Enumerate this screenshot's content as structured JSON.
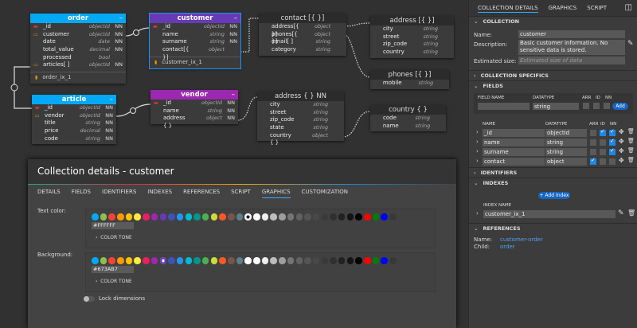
{
  "entities": [
    {
      "id": "order",
      "title": "order",
      "color": "#03A9F4",
      "rows": [
        [
          "key",
          "_id",
          "objectId",
          "NN"
        ],
        [
          "fk",
          "customer",
          "objectId",
          "NN"
        ],
        [
          "",
          "date",
          "date",
          "NN"
        ],
        [
          "",
          "total_value",
          "decimal",
          "NN"
        ],
        [
          "",
          "processed",
          "bool",
          ""
        ],
        [
          "fk",
          "articles[ ]",
          "objectId",
          "NN"
        ]
      ],
      "index": "order_ix_1"
    },
    {
      "id": "customer",
      "title": "customer",
      "color": "#673AB7",
      "rows": [
        [
          "key",
          "_id",
          "objectId",
          "NN"
        ],
        [
          "",
          "name",
          "string",
          "NN"
        ],
        [
          "",
          "surname",
          "string",
          "NN"
        ],
        [
          "",
          "contact[{ }]",
          "object",
          ""
        ]
      ],
      "index": "customer_ix_1"
    },
    {
      "id": "article",
      "title": "article",
      "color": "#03A9F4",
      "rows": [
        [
          "key",
          "_id",
          "objectId",
          "NN"
        ],
        [
          "fk",
          "vendor",
          "objectId",
          "NN"
        ],
        [
          "",
          "title",
          "string",
          "NN"
        ],
        [
          "",
          "price",
          "decimal",
          "NN"
        ],
        [
          "",
          "code",
          "string",
          "NN"
        ]
      ]
    },
    {
      "id": "vendor",
      "title": "vendor",
      "color": "#9C27B0",
      "rows": [
        [
          "key",
          "_id",
          "objectId",
          "NN"
        ],
        [
          "",
          "name",
          "string",
          "NN"
        ],
        [
          "",
          "address { }",
          "object",
          "NN"
        ]
      ]
    },
    {
      "id": "contact",
      "title": "contact [{ }]",
      "sub": true,
      "rows": [
        [
          "",
          "address[{ }]",
          "object",
          ""
        ],
        [
          "",
          "phones[{ }]",
          "object",
          ""
        ],
        [
          "",
          "email[ ]",
          "string",
          ""
        ],
        [
          "",
          "category",
          "string",
          ""
        ]
      ]
    },
    {
      "id": "address1",
      "title": "address [{ }]",
      "sub": true,
      "rows": [
        [
          "",
          "city",
          "string",
          ""
        ],
        [
          "",
          "street",
          "string",
          ""
        ],
        [
          "",
          "zip_code",
          "string",
          ""
        ],
        [
          "",
          "country",
          "string",
          ""
        ]
      ]
    },
    {
      "id": "phones",
      "title": "phones [{ }]",
      "sub": true,
      "rows": [
        [
          "",
          "mobile",
          "string",
          ""
        ]
      ]
    },
    {
      "id": "address2",
      "title": "address { } NN",
      "sub": true,
      "rows": [
        [
          "",
          "city",
          "string",
          ""
        ],
        [
          "",
          "street",
          "string",
          ""
        ],
        [
          "",
          "zip_code",
          "string",
          ""
        ],
        [
          "",
          "state",
          "string",
          ""
        ],
        [
          "",
          "country { }",
          "object",
          ""
        ]
      ]
    },
    {
      "id": "country",
      "title": "country { }",
      "sub": true,
      "rows": [
        [
          "",
          "code",
          "string",
          ""
        ],
        [
          "",
          "name",
          "string",
          ""
        ]
      ]
    }
  ],
  "dialog": {
    "title": "Collection details - customer",
    "tabs": [
      "DETAILS",
      "FIELDS",
      "IDENTIFIERS",
      "INDEXES",
      "REFERENCES",
      "SCRIPT",
      "GRAPHICS",
      "CUSTOMIZATION"
    ],
    "active_tab": "GRAPHICS",
    "text_color_label": "Text color:",
    "text_color_value": "#FFFFFF",
    "text_selected": 18,
    "background_label": "Background:",
    "background_value": "#673AB7",
    "background_selected": 8,
    "color_tone": "COLOR TONE",
    "lock_label": "Lock dimensions",
    "palette": [
      "#03A9F4",
      "#8BC34A",
      "#F44336",
      "#FF9800",
      "#FFC107",
      "#FFEB3B",
      "#E91E63",
      "#9C27B0",
      "#673AB7",
      "#3F51B5",
      "#2196F3",
      "#00BCD4",
      "#009688",
      "#4CAF50",
      "#CDDC39",
      "#FF5722",
      "#795548",
      "#607D8B",
      "#FFFFFF",
      "#FAFAFA",
      "#EEEEEE",
      "#BDBDBD",
      "#9E9E9E",
      "#757575",
      "#616161",
      "#545454",
      "#484848",
      "#3a3a3a",
      "#303030",
      "#212121",
      "#141414",
      "#000000",
      "#FF0000",
      "#008000",
      "#0000FF",
      "#383838"
    ]
  },
  "panel": {
    "tabs": [
      "COLLECTION DETAILS",
      "GRAPHICS",
      "SCRIPT"
    ],
    "collection": "COLLECTION",
    "name_label": "Name:",
    "name_value": "customer",
    "desc_label": "Description:",
    "desc_value": "Basic customer information. No sensitive data is stored.",
    "size_label": "Estimated size:",
    "size_placeholder": "Estimated size of data",
    "specifics": "COLLECTION SPECIFICS",
    "fields": "FIELDS",
    "field_name_h": "FIELD NAME",
    "datatype_h": "DATATYPE",
    "arr_h": "ARR",
    "id_h": "ID",
    "nn_h": "NN",
    "new_type": "string",
    "add": "Add",
    "name_h": "NAME",
    "field_rows": [
      {
        "name": "_id",
        "type": "objectId",
        "arr": false,
        "id": true,
        "nn": true
      },
      {
        "name": "name",
        "type": "string",
        "arr": false,
        "id": false,
        "nn": true
      },
      {
        "name": "surname",
        "type": "string",
        "arr": false,
        "id": false,
        "nn": true
      },
      {
        "name": "contact",
        "type": "object",
        "arr": true,
        "id": false,
        "nn": false
      }
    ],
    "identifiers": "IDENTIFIERS",
    "indexes": "INDEXES",
    "add_index": "+ Add Index",
    "index_name_h": "INDEX NAME",
    "index_value": "customer_ix_1",
    "references": "REFERENCES",
    "ref_name_label": "Name:",
    "ref_name": "customer-order",
    "ref_child_label": "Child:",
    "ref_child": "order"
  }
}
